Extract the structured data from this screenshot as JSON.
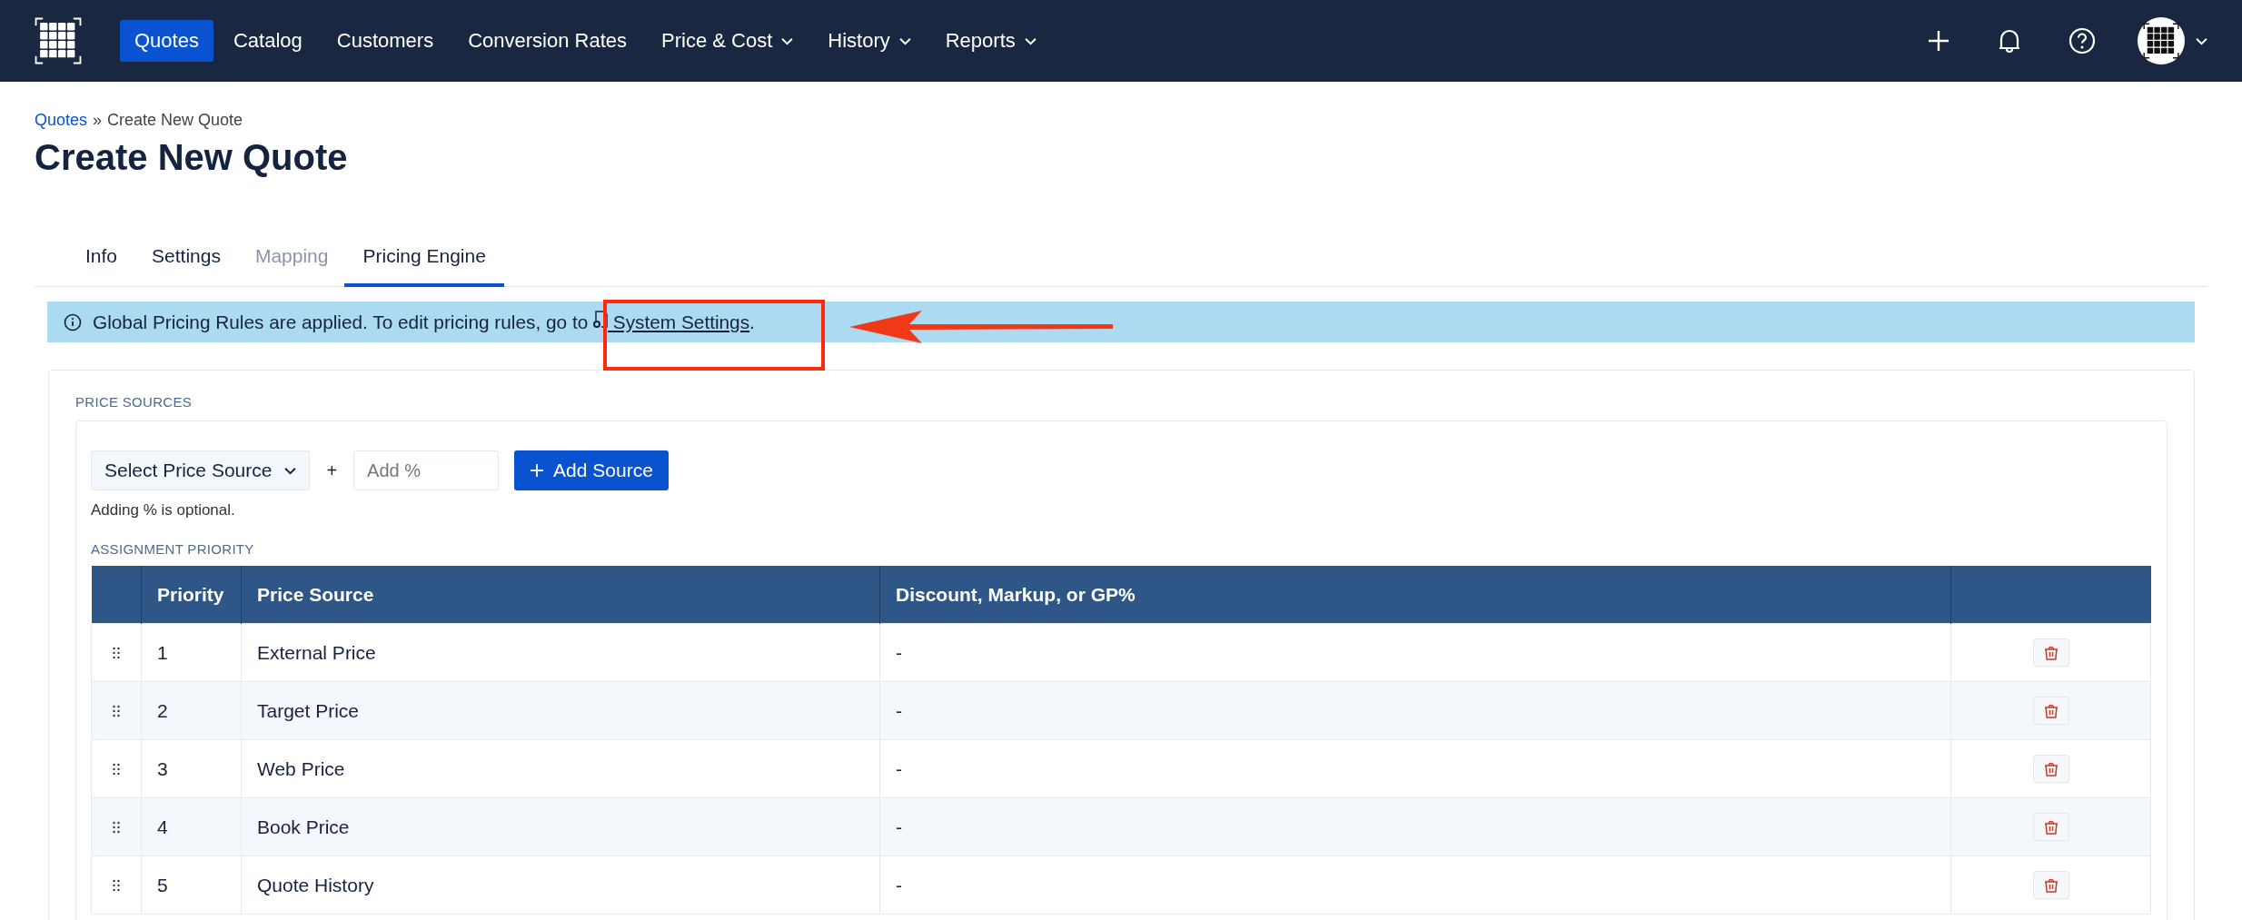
{
  "nav": {
    "items": [
      {
        "label": "Quotes",
        "selected": true,
        "has_menu": false
      },
      {
        "label": "Catalog",
        "selected": false,
        "has_menu": false
      },
      {
        "label": "Customers",
        "selected": false,
        "has_menu": false
      },
      {
        "label": "Conversion Rates",
        "selected": false,
        "has_menu": false
      },
      {
        "label": "Price & Cost",
        "selected": false,
        "has_menu": true
      },
      {
        "label": "History",
        "selected": false,
        "has_menu": true
      },
      {
        "label": "Reports",
        "selected": false,
        "has_menu": true
      }
    ]
  },
  "breadcrumb": {
    "link": "Quotes",
    "separator": "»",
    "current": "Create New Quote"
  },
  "title": "Create New Quote",
  "tabs": [
    {
      "label": "Info",
      "selected": false,
      "disabled": false
    },
    {
      "label": "Settings",
      "selected": false,
      "disabled": false
    },
    {
      "label": "Mapping",
      "selected": false,
      "disabled": true
    },
    {
      "label": "Pricing Engine",
      "selected": true,
      "disabled": false
    }
  ],
  "notice": {
    "text": "Global Pricing Rules are applied. To edit pricing rules, go to",
    "link": " System Settings",
    "end": "."
  },
  "price_sources": {
    "heading": "PRICE SOURCES",
    "select": {
      "value": "Select Price Source"
    },
    "plus": "+",
    "percent": {
      "placeholder": "Add %"
    },
    "add_button": "Add Source",
    "hint": "Adding % is optional."
  },
  "assignment": {
    "heading": "ASSIGNMENT PRIORITY",
    "columns": [
      "Priority",
      "Price Source",
      "Discount, Markup, or GP%"
    ],
    "rows": [
      {
        "priority": "1",
        "source": "External Price",
        "adjustment": "-"
      },
      {
        "priority": "2",
        "source": "Target Price",
        "adjustment": "-"
      },
      {
        "priority": "3",
        "source": "Web Price",
        "adjustment": "-"
      },
      {
        "priority": "4",
        "source": "Book Price",
        "adjustment": "-"
      },
      {
        "priority": "5",
        "source": "Quote History",
        "adjustment": "-"
      }
    ]
  }
}
